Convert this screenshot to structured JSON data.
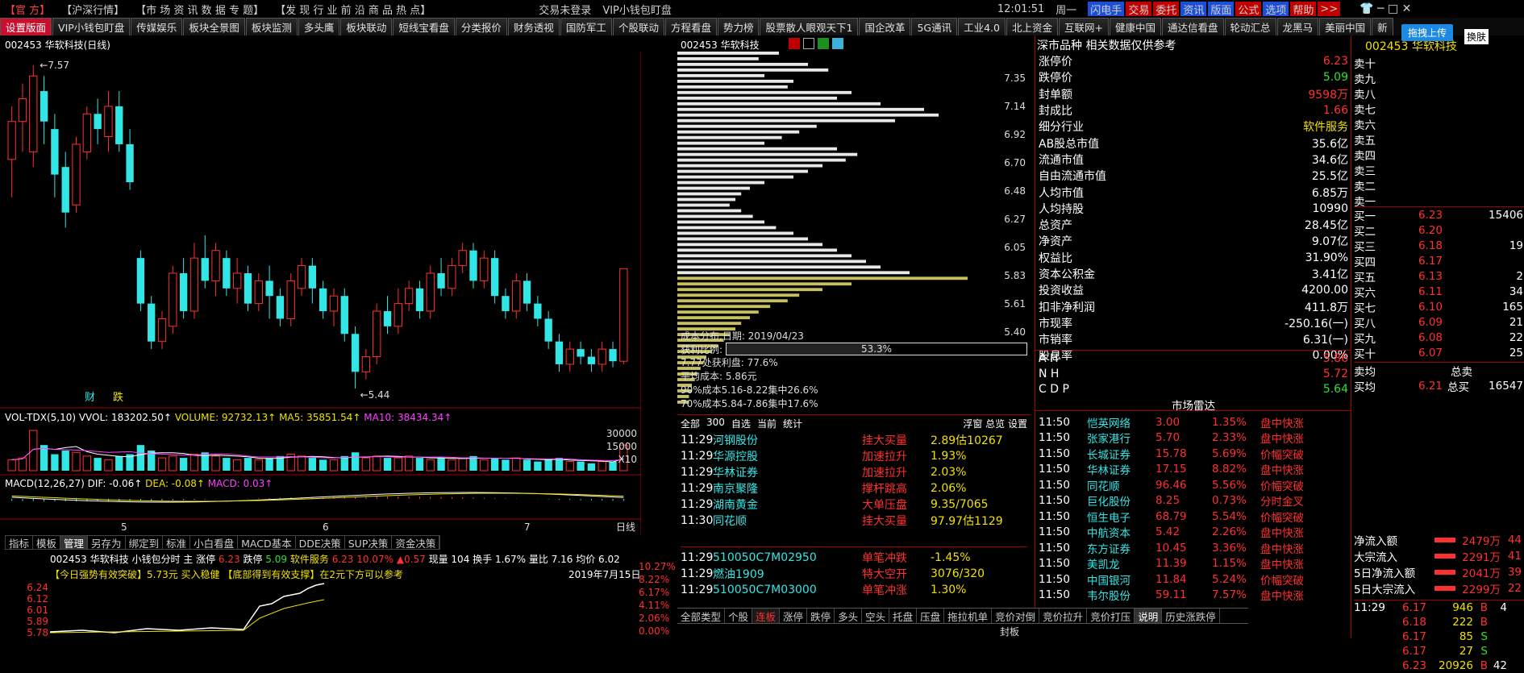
{
  "menu": {
    "official": "【官 方】",
    "market_sel": "【沪深行情】",
    "items": "【市 场  资 讯  数 据  专 题】",
    "items2": "【发 现  行 业  前 沿  商 品  热 点】",
    "login": "交易未登录",
    "title": "VIP小钱包盯盘",
    "time": "12:01:51",
    "weekday": "周一",
    "right_btns": [
      {
        "label": "闪电手",
        "bg": "#1c4fd6"
      },
      {
        "label": "交易",
        "bg": "#c00000"
      },
      {
        "label": "委托",
        "bg": "#c00000"
      },
      {
        "label": "资讯",
        "bg": "#1c4fd6"
      },
      {
        "label": "版面",
        "bg": "#1c4fd6"
      },
      {
        "label": "公式",
        "bg": "#c00000"
      },
      {
        "label": "选项",
        "bg": "#1c4fd6"
      },
      {
        "label": "帮助",
        "bg": "#c00000"
      },
      {
        "label": ">>",
        "bg": "#c00000"
      }
    ]
  },
  "tabs": [
    "设置版面",
    "VIP小钱包盯盘",
    "传媒娱乐",
    "板块全景图",
    "板块监测",
    "多头鹰",
    "板块联动",
    "短线宝看盘",
    "分类报价",
    "财务透视",
    "国防军工",
    "个股联动",
    "方程看盘",
    "势力榜",
    "股票散人眼观天下1",
    "国企改革",
    "5G通讯",
    "工业4.0",
    "北上资金",
    "互联网+",
    "健康中国",
    "通达信看盘",
    "轮动汇总",
    "龙黑马",
    "美丽中国",
    "新"
  ],
  "kline": {
    "header": "002453 华软科技(日线)",
    "high": "7.57",
    "low": "5.44",
    "marks": [
      "财",
      "跌"
    ],
    "vol_label": "VOL-TDX(5,10) VVOL: 183202.50↑",
    "volume": "VOLUME: 92732.13↑",
    "ma5": "MA5: 35851.54↑",
    "ma10": "MA10: 38434.34↑",
    "vol_ticks": [
      "30000",
      "15000",
      "X10"
    ],
    "macd_label": "MACD(12,26,27) DIF: -0.06↑",
    "dea": "DEA: -0.08↑",
    "macd": "MACD: 0.03↑",
    "months": [
      "5",
      "6",
      "7"
    ],
    "tail": "日线",
    "candles": [
      [
        6.95,
        7.2,
        6.7,
        7.3
      ],
      [
        7.2,
        7.35,
        7.0,
        7.45
      ],
      [
        7.0,
        7.5,
        6.9,
        7.57
      ],
      [
        7.4,
        7.2,
        7.05,
        7.5
      ],
      [
        7.15,
        6.85,
        6.7,
        7.25
      ],
      [
        6.9,
        6.6,
        6.5,
        7.0
      ],
      [
        6.65,
        7.05,
        6.6,
        7.1
      ],
      [
        7.0,
        7.25,
        6.95,
        7.3
      ],
      [
        7.25,
        7.15,
        7.05,
        7.35
      ],
      [
        7.1,
        7.3,
        7.0,
        7.4
      ],
      [
        7.3,
        7.05,
        7.0,
        7.4
      ],
      [
        7.05,
        6.8,
        6.75,
        7.15
      ],
      [
        6.3,
        6.0,
        5.95,
        6.35
      ],
      [
        6.0,
        5.75,
        5.7,
        6.05
      ],
      [
        5.75,
        5.9,
        5.7,
        5.95
      ],
      [
        5.85,
        6.2,
        5.8,
        6.25
      ],
      [
        6.2,
        5.95,
        5.9,
        6.3
      ],
      [
        5.95,
        6.3,
        5.9,
        6.4
      ],
      [
        6.3,
        6.15,
        6.1,
        6.45
      ],
      [
        6.15,
        6.35,
        6.05,
        6.4
      ],
      [
        6.3,
        6.1,
        6.05,
        6.35
      ],
      [
        6.1,
        6.2,
        6.0,
        6.3
      ],
      [
        6.2,
        6.0,
        5.95,
        6.25
      ],
      [
        6.0,
        6.15,
        5.95,
        6.2
      ],
      [
        6.15,
        6.05,
        5.9,
        6.25
      ],
      [
        6.05,
        5.9,
        5.85,
        6.1
      ],
      [
        5.9,
        6.15,
        5.85,
        6.2
      ],
      [
        6.1,
        6.25,
        6.05,
        6.3
      ],
      [
        6.25,
        6.1,
        6.0,
        6.3
      ],
      [
        6.1,
        5.95,
        5.9,
        6.15
      ],
      [
        5.95,
        6.05,
        5.85,
        6.1
      ],
      [
        6.05,
        5.8,
        5.75,
        6.1
      ],
      [
        5.8,
        5.55,
        5.44,
        5.85
      ],
      [
        5.55,
        5.65,
        5.5,
        5.7
      ],
      [
        5.65,
        5.95,
        5.6,
        6.0
      ],
      [
        5.95,
        5.85,
        5.8,
        6.05
      ],
      [
        5.85,
        6.0,
        5.8,
        6.1
      ],
      [
        6.0,
        6.1,
        5.95,
        6.15
      ],
      [
        6.1,
        5.95,
        5.9,
        6.15
      ],
      [
        5.95,
        6.2,
        5.9,
        6.25
      ],
      [
        6.2,
        6.1,
        6.05,
        6.3
      ],
      [
        6.1,
        6.25,
        6.05,
        6.3
      ],
      [
        6.25,
        6.35,
        6.2,
        6.4
      ],
      [
        6.35,
        6.15,
        6.1,
        6.4
      ],
      [
        6.15,
        6.3,
        6.1,
        6.35
      ],
      [
        6.3,
        6.05,
        6.0,
        6.35
      ],
      [
        6.05,
        5.95,
        5.9,
        6.1
      ],
      [
        5.95,
        6.15,
        5.9,
        6.2
      ],
      [
        6.15,
        6.0,
        5.95,
        6.2
      ],
      [
        6.0,
        5.9,
        5.85,
        6.05
      ],
      [
        5.9,
        5.75,
        5.7,
        5.95
      ],
      [
        5.75,
        5.6,
        5.55,
        5.8
      ],
      [
        5.6,
        5.7,
        5.55,
        5.75
      ],
      [
        5.7,
        5.65,
        5.6,
        5.75
      ],
      [
        5.65,
        5.6,
        5.55,
        5.7
      ],
      [
        5.6,
        5.7,
        5.55,
        5.75
      ],
      [
        5.7,
        5.62,
        5.58,
        5.75
      ],
      [
        5.62,
        6.23,
        5.6,
        6.23
      ]
    ],
    "vols": [
      6,
      7,
      22,
      14,
      9,
      11,
      10,
      8,
      7,
      6,
      8,
      9,
      14,
      11,
      7,
      8,
      7,
      9,
      10,
      8,
      7,
      6,
      7,
      6,
      7,
      8,
      9,
      8,
      7,
      6,
      6,
      8,
      10,
      7,
      8,
      7,
      7,
      8,
      7,
      6,
      7,
      6,
      7,
      8,
      6,
      7,
      6,
      7,
      6,
      5,
      6,
      7,
      5,
      5,
      4,
      5,
      5,
      14
    ]
  },
  "chips": {
    "header": "002453 华软科技",
    "ticks": [
      "7.35",
      "7.14",
      "6.92",
      "6.70",
      "6.48",
      "6.27",
      "6.05",
      "5.83",
      "5.61",
      "5.40"
    ],
    "info_date": "成本分布,日期: 2019/04/23",
    "profit_label": "获利比例:",
    "profit_pct": "53.3%",
    "lines": [
      "7.77处获利盘: 77.6%",
      "平均成本: 5.86元",
      "90%成本5.16-8.22集中26.6%",
      "70%成本5.84-7.86集中17.6%"
    ],
    "bars": [
      0.35,
      0.28,
      0.45,
      0.52,
      0.3,
      0.4,
      0.38,
      0.6,
      0.55,
      0.7,
      0.85,
      0.9,
      0.75,
      0.48,
      0.42,
      0.36,
      0.3,
      0.55,
      0.62,
      0.58,
      0.5,
      0.45,
      0.4,
      0.3,
      0.25,
      0.22,
      0.2,
      0.18,
      0.22,
      0.26,
      0.3,
      0.34,
      0.4,
      0.45,
      0.5,
      0.55,
      0.6,
      0.65,
      0.7,
      0.8,
      1.0,
      0.6,
      0.5,
      0.42,
      0.38,
      0.32,
      0.28,
      0.25,
      0.22,
      0.2,
      0.18,
      0.16,
      0.14,
      0.12,
      0.1,
      0.09,
      0.08,
      0.07,
      0.06,
      0.05,
      0.05,
      0.04,
      0.04
    ]
  },
  "radar_list": {
    "tabs": [
      "全部",
      "300",
      "自选",
      "当前",
      "统计"
    ],
    "right": "浮窗 总览 设置",
    "rows": [
      {
        "t": "11:29",
        "name": "河钢股份",
        "type": "挂大买量",
        "val": "2.89估10267"
      },
      {
        "t": "11:29",
        "name": "华源控股",
        "type": "加速拉升",
        "val": "1.93%"
      },
      {
        "t": "11:29",
        "name": "华林证券",
        "type": "加速拉升",
        "val": "2.03%"
      },
      {
        "t": "11:29",
        "name": "南京聚隆",
        "type": "撑杆跳高",
        "val": "2.06%"
      },
      {
        "t": "11:29",
        "name": "湖南黄金",
        "type": "大单压盘",
        "val": "9.35/7065"
      },
      {
        "t": "11:30",
        "name": "同花顺",
        "type": "挂大买量",
        "val": "97.97估1129"
      }
    ],
    "rows2": [
      {
        "t": "11:29",
        "name": "510050C7M02950",
        "type": "单笔冲跌",
        "val": "-1.45%"
      },
      {
        "t": "11:29",
        "name": "燃油1909",
        "type": "特大空开",
        "val": "3076/320"
      },
      {
        "t": "11:29",
        "name": "510050C7M03000",
        "type": "单笔冲涨",
        "val": "1.30%"
      }
    ]
  },
  "bottom_tabs": {
    "label": "全部类型",
    "items": [
      "个股",
      "连板",
      "涨停",
      "跌停",
      "多头",
      "空头",
      "托盘",
      "压盘",
      "拖拉机单",
      "竞价对倒",
      "竞价拉升",
      "竞价打压"
    ],
    "explain": "说明",
    "history": "历史涨跌停",
    "sub": "封板"
  },
  "fin": {
    "header": "深市品种 相关数据仅供参考",
    "rows": [
      {
        "k": "涨停价",
        "v": "6.23",
        "c": "red"
      },
      {
        "k": "跌停价",
        "v": "5.09",
        "c": "green"
      },
      {
        "k": "封单额",
        "v": "9598万",
        "c": "red"
      },
      {
        "k": "封成比",
        "v": "1.66",
        "c": "red"
      },
      {
        "k": "细分行业",
        "v": "软件服务",
        "c": "yellow"
      },
      {
        "k": "AB股总市值",
        "v": "35.6亿",
        "c": "white"
      },
      {
        "k": "流通市值",
        "v": "34.6亿",
        "c": "white"
      },
      {
        "k": "自由流通市值",
        "v": "25.5亿",
        "c": "white"
      },
      {
        "k": "人均市值",
        "v": "6.85万",
        "c": "white"
      },
      {
        "k": "人均持股",
        "v": "10990",
        "c": "white"
      },
      {
        "k": "总资产",
        "v": "28.45亿",
        "c": "white"
      },
      {
        "k": "净资产",
        "v": "9.07亿",
        "c": "white"
      },
      {
        "k": "权益比",
        "v": "31.90%",
        "c": "white"
      },
      {
        "k": "资本公积金",
        "v": "3.41亿",
        "c": "white"
      },
      {
        "k": "投资收益",
        "v": "4200.00",
        "c": "white"
      },
      {
        "k": "扣非净利润",
        "v": "411.8万",
        "c": "white"
      },
      {
        "k": "市现率",
        "v": "-250.16(一)",
        "c": "white"
      },
      {
        "k": "市销率",
        "v": "6.31(一)",
        "c": "white"
      },
      {
        "k": "股息率",
        "v": "0.00%",
        "c": "white"
      }
    ],
    "ah": [
      {
        "k": "A H",
        "v": "5.86",
        "c": "red"
      },
      {
        "k": "N H",
        "v": "5.72",
        "c": "red"
      },
      {
        "k": "C D P",
        "v": "5.64",
        "c": "green"
      }
    ]
  },
  "radar": {
    "title": "市场雷达",
    "rows": [
      {
        "t": "11:50",
        "n": "恺英网络",
        "p": "3.00",
        "c": "1.35%",
        "e": "盘中快涨"
      },
      {
        "t": "11:50",
        "n": "张家港行",
        "p": "5.70",
        "c": "2.33%",
        "e": "盘中快涨"
      },
      {
        "t": "11:50",
        "n": "长城证券",
        "p": "15.78",
        "c": "5.69%",
        "e": "价幅突破"
      },
      {
        "t": "11:50",
        "n": "华林证券",
        "p": "17.15",
        "c": "8.82%",
        "e": "盘中快涨"
      },
      {
        "t": "11:50",
        "n": "同花顺",
        "p": "96.46",
        "c": "5.56%",
        "e": "价幅突破"
      },
      {
        "t": "11:50",
        "n": "巨化股份",
        "p": "8.25",
        "c": "0.73%",
        "e": "分时金叉"
      },
      {
        "t": "11:50",
        "n": "恒生电子",
        "p": "68.79",
        "c": "5.54%",
        "e": "价幅突破"
      },
      {
        "t": "11:50",
        "n": "中航资本",
        "p": "5.42",
        "c": "2.26%",
        "e": "盘中快涨"
      },
      {
        "t": "11:50",
        "n": "东方证券",
        "p": "10.45",
        "c": "3.36%",
        "e": "盘中快涨"
      },
      {
        "t": "11:50",
        "n": "美凯龙",
        "p": "11.39",
        "c": "1.15%",
        "e": "盘中快涨"
      },
      {
        "t": "11:50",
        "n": "中国银河",
        "p": "11.84",
        "c": "5.24%",
        "e": "价幅突破"
      },
      {
        "t": "11:50",
        "n": "韦尔股份",
        "p": "59.11",
        "c": "7.57%",
        "e": "盘中快涨"
      }
    ]
  },
  "orderbook": {
    "header": "002453 华软科技",
    "upload": "拖拽上传",
    "swap": "换肤",
    "sells": [
      "卖十",
      "卖九",
      "卖八",
      "卖七",
      "卖六",
      "卖五",
      "卖四",
      "卖三",
      "卖二",
      "卖一"
    ],
    "buys": [
      {
        "k": "买一",
        "p": "6.23",
        "v": "15406"
      },
      {
        "k": "买二",
        "p": "6.20",
        "v": ""
      },
      {
        "k": "买三",
        "p": "6.18",
        "v": "19"
      },
      {
        "k": "买四",
        "p": "6.17",
        "v": ""
      },
      {
        "k": "买五",
        "p": "6.13",
        "v": "2"
      },
      {
        "k": "买六",
        "p": "6.11",
        "v": "34"
      },
      {
        "k": "买七",
        "p": "6.10",
        "v": "165"
      },
      {
        "k": "买八",
        "p": "6.09",
        "v": "21"
      },
      {
        "k": "买九",
        "p": "6.08",
        "v": "22"
      },
      {
        "k": "买十",
        "p": "6.07",
        "v": "25"
      }
    ],
    "sell_avg": "卖均",
    "total_sell": "总卖",
    "buy_avg": "买均",
    "buy_avg_p": "6.21",
    "total_buy": "总买",
    "total_buy_v": "16547",
    "flow": [
      {
        "k": "净流入额",
        "v": "2479万",
        "v2": "44"
      },
      {
        "k": "大宗流入",
        "v": "2291万",
        "v2": "41"
      },
      {
        "k": "5日净流入额",
        "v": "2041万",
        "v2": "39"
      },
      {
        "k": "5日大宗流入",
        "v": "2299万",
        "v2": "22"
      }
    ],
    "ticks": [
      {
        "t": "11:29",
        "p": "6.17",
        "v": "946",
        "bs": "B",
        "n": "4"
      },
      {
        "t": "",
        "p": "6.18",
        "v": "222",
        "bs": "B",
        "n": ""
      },
      {
        "t": "",
        "p": "6.17",
        "v": "85",
        "bs": "S",
        "n": ""
      },
      {
        "t": "",
        "p": "6.17",
        "v": "27",
        "bs": "S",
        "n": ""
      },
      {
        "t": "",
        "p": "6.23",
        "v": "20926",
        "bs": "B",
        "n": "42"
      }
    ]
  },
  "intraday": {
    "tabs": [
      "指标",
      "模板",
      "管理",
      "另存为",
      "绑定到",
      "标准",
      "小白看盘",
      "MACD基本",
      "DDE决策",
      "SUP决策",
      "资金决策"
    ],
    "header": "002453 华软科技  小钱包分时 主  涨停",
    "zt": "6.23",
    "dt_label": "跌停",
    "dt": "5.09",
    "industry": "软件服务",
    "price": "6.23",
    "pct": "10.07%",
    "chg": "▲0.57",
    "vol": "现量 104 换手 1.67% 量比 7.16 均价 6.02",
    "signal": "【今日强势有效突破】5.73元 买入稳健 【底部得到有效支撑】在2元下方可以参考",
    "date": "2019年7月15日",
    "yticks": [
      "6.24",
      "6.12",
      "6.01",
      "5.89",
      "5.78"
    ],
    "pct_ticks": [
      "10.27%",
      "8.22%",
      "6.17%",
      "4.11%",
      "2.06%",
      "0.00%"
    ]
  }
}
